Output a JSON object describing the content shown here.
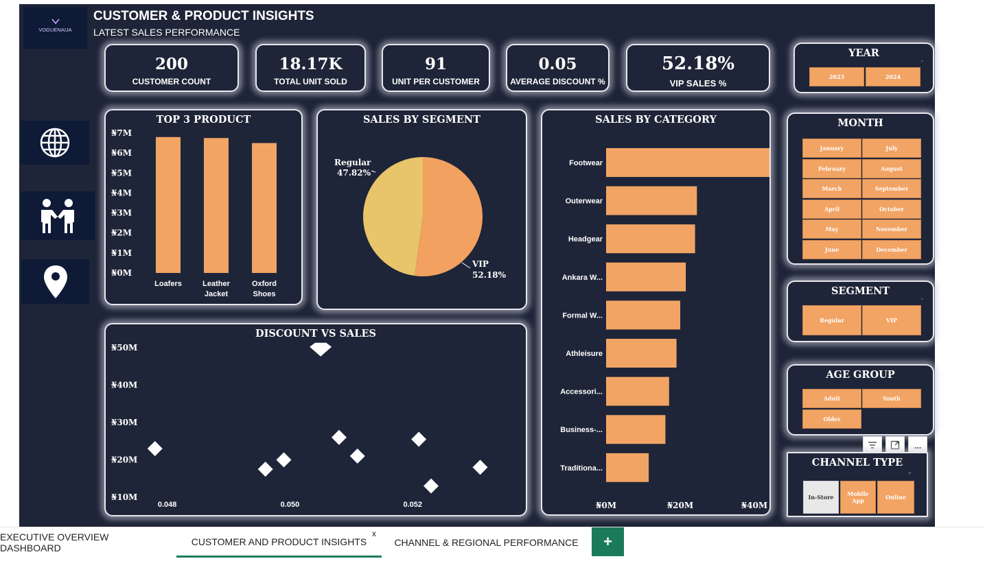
{
  "header": {
    "logo_text": "VOGUENAIJA",
    "title": "CUSTOMER & PRODUCT INSIGHTS",
    "subtitle": "LATEST SALES PERFORMANCE"
  },
  "kpis": [
    {
      "value": "200",
      "label": "CUSTOMER COUNT"
    },
    {
      "value": "18.17K",
      "label": "TOTAL UNIT SOLD"
    },
    {
      "value": "91",
      "label": "UNIT PER CUSTOMER"
    },
    {
      "value": "0.05",
      "label": "AVERAGE DISCOUNT %"
    },
    {
      "value": "52.18%",
      "label": "VIP SALES %"
    }
  ],
  "nav_icons": [
    "globe-icon",
    "handshake-icon",
    "location-pin-icon"
  ],
  "slicers": {
    "year": {
      "title": "YEAR",
      "options": [
        "2023",
        "2024"
      ]
    },
    "month": {
      "title": "MONTH",
      "options": [
        "January",
        "July",
        "February",
        "August",
        "March",
        "September",
        "April",
        "October",
        "May",
        "November",
        "June",
        "December"
      ]
    },
    "segment": {
      "title": "SEGMENT",
      "options": [
        "Regular",
        "VIP"
      ]
    },
    "age_group": {
      "title": "AGE GROUP",
      "options": [
        "Adult",
        "Youth",
        "Older"
      ]
    },
    "channel_type": {
      "title": "CHANNEL TYPE",
      "options": [
        "In-Store",
        "Mobile App",
        "Online"
      ]
    }
  },
  "toolbar": {
    "filter_icon": "filter-icon",
    "focus_icon": "focus-mode-icon",
    "more_label": "..."
  },
  "tabs": [
    {
      "label": "EXECUTIVE OVERVIEW DASHBOARD"
    },
    {
      "label": "CUSTOMER AND PRODUCT INSIGHTS",
      "active": true,
      "close": "x"
    },
    {
      "label": "CHANNEL & REGIONAL PERFORMANCE"
    }
  ],
  "add_tab_label": "+",
  "accent_color": "#f2a465",
  "panel_bg": "#1e2538",
  "chart_data": [
    {
      "type": "bar",
      "title": "TOP 3 PRODUCT",
      "categories": [
        "Loafers",
        "Leather Jacket",
        "Oxford Shoes"
      ],
      "category_lines": [
        [
          "Loafers"
        ],
        [
          "Leather",
          "Jacket"
        ],
        [
          "Oxford",
          "Shoes"
        ]
      ],
      "values": [
        6.8,
        6.75,
        6.5
      ],
      "unit": "M",
      "yticks": [
        "₦0M",
        "₦1M",
        "₦2M",
        "₦3M",
        "₦4M",
        "₦5M",
        "₦6M",
        "₦7M"
      ],
      "ylim": [
        0,
        7
      ],
      "grid": false
    },
    {
      "type": "pie",
      "title": "SALES BY SEGMENT",
      "slices": [
        {
          "name": "VIP",
          "value": 52.18,
          "label": "52.18%",
          "color": "#f2a160"
        },
        {
          "name": "Regular",
          "value": 47.82,
          "label": "47.82%",
          "color": "#e8c46a"
        }
      ]
    },
    {
      "type": "bar",
      "orientation": "horizontal",
      "title": "SALES BY CATEGORY",
      "categories": [
        "Footwear",
        "Outerwear",
        "Headgear",
        "Ankara W...",
        "Formal W...",
        "Athleisure",
        "Accessori...",
        "Business-...",
        "Traditiona..."
      ],
      "values": [
        47,
        24.5,
        24,
        21.5,
        20,
        19,
        17,
        16,
        11.5
      ],
      "xticks": [
        "₦0M",
        "₦20M",
        "₦40M"
      ],
      "xlim": [
        0,
        50
      ],
      "grid": false
    },
    {
      "type": "scatter",
      "title": "DISCOUNT VS SALES",
      "marker": "diamond",
      "points": [
        {
          "x": 0.0478,
          "y": 23
        },
        {
          "x": 0.0496,
          "y": 17.5
        },
        {
          "x": 0.0499,
          "y": 20
        },
        {
          "x": 0.0505,
          "y": 49.5
        },
        {
          "x": 0.0508,
          "y": 26
        },
        {
          "x": 0.0511,
          "y": 21
        },
        {
          "x": 0.0521,
          "y": 25.5
        },
        {
          "x": 0.0523,
          "y": 13
        },
        {
          "x": 0.0531,
          "y": 18
        }
      ],
      "xticks": [
        {
          "value": 0.048,
          "label": "0.048"
        },
        {
          "value": 0.05,
          "label": "0.050"
        },
        {
          "value": 0.052,
          "label": "0.052"
        }
      ],
      "yticks": [
        {
          "value": 10,
          "label": "₦10M"
        },
        {
          "value": 20,
          "label": "₦20M"
        },
        {
          "value": 30,
          "label": "₦30M"
        },
        {
          "value": 40,
          "label": "₦40M"
        },
        {
          "value": 50,
          "label": "₦50M"
        }
      ],
      "xlim": [
        0.0474,
        0.054
      ],
      "ylim": [
        10,
        50
      ]
    }
  ]
}
